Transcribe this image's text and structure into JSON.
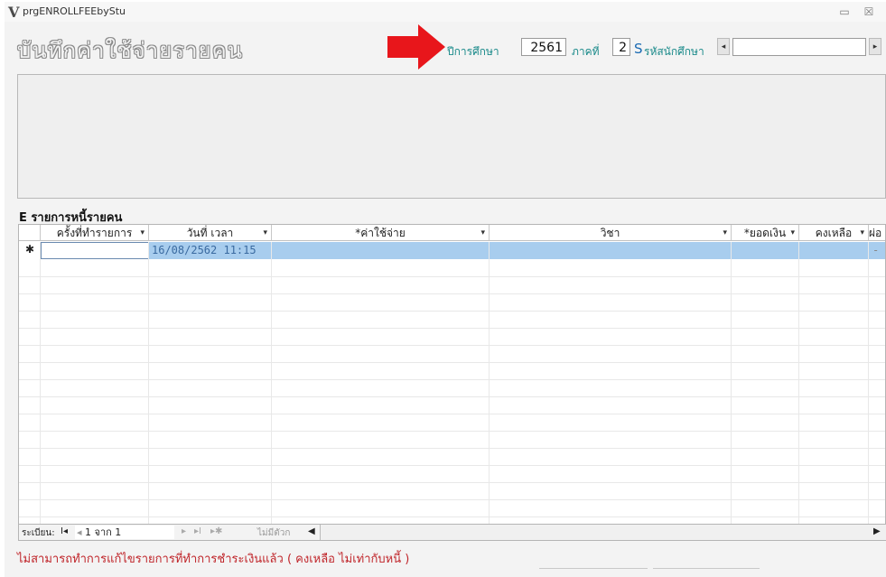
{
  "window": {
    "logo": "V",
    "title": "prgENROLLFEEbyStu",
    "minimize_icon": "▭",
    "close_icon": "☒"
  },
  "form": {
    "title": "บันทึกค่าใช้จ่ายรายคน"
  },
  "header": {
    "year_label": "ปีการศึกษา",
    "year_value": "2561",
    "term_label": "ภาคที่",
    "term_value": "2",
    "s_label": "S",
    "student_id_label": "รหัสนักศึกษา",
    "student_id_value": "",
    "arrow_color": "#e8161b"
  },
  "grid": {
    "section_label": "E รายการหนี้รายคน",
    "columns": [
      "ครั้งที่ทำรายการ",
      "วันที่ เวลา",
      "*ค่าใช้จ่าย",
      "วิชา",
      "*ยอดเงิน",
      "คงเหลือ",
      "ผ่อ"
    ],
    "new_row_marker": "✱",
    "rows": [
      {
        "round": "",
        "datetime": "16/08/2562 11:15",
        "expense": "",
        "subject": "",
        "amount": "",
        "balance": "",
        "installment": "-"
      }
    ]
  },
  "navigator": {
    "record_label": "ระเบียน:",
    "first": "I◂",
    "prev": "◂",
    "position": "1 จาก 1",
    "next": "▸",
    "last": "▸I",
    "new": "▸✱",
    "filter_label": "ไม่มีตัวก",
    "scroll_left": "◀",
    "scroll_right": "▶"
  },
  "status": {
    "message": "ไม่สามารถทำการแก้ไขรายการที่ทำการชำระเงินแล้ว ( คงเหลือ ไม่เท่ากับหนี้ )"
  }
}
